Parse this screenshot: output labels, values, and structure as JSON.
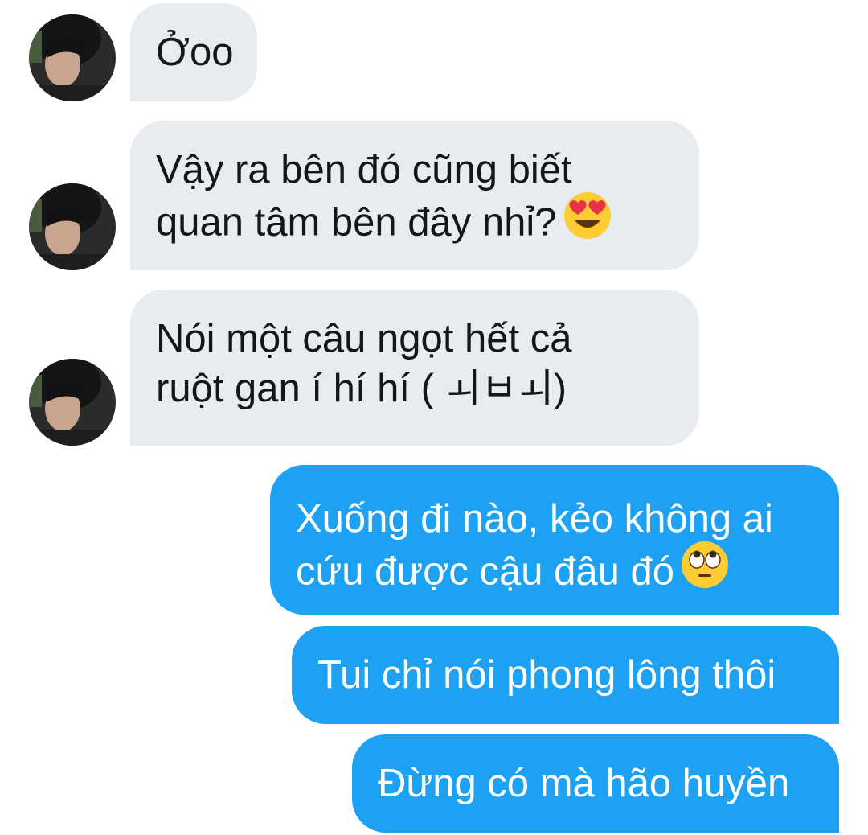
{
  "conversation": {
    "incoming": [
      {
        "text": "Ởoo"
      },
      {
        "line1": "Vậy ra bên đó cũng biết",
        "line2": "quan tâm bên đây nhỉ?",
        "emoji": "heart-eyes-emoji"
      },
      {
        "line1": "Nói một câu ngọt hết cả",
        "line2": "ruột gan í hí hí ( ㅚㅂㅚ)"
      }
    ],
    "outgoing": [
      {
        "line1": "Xuống đi nào, kẻo không ai",
        "line2": "cứu được cậu đâu đó",
        "emoji": "eye-roll-emoji"
      },
      {
        "text": "Tui chỉ nói phong lông thôi"
      },
      {
        "text": "Đừng có mà hão huyền"
      }
    ]
  },
  "colors": {
    "incoming_bubble": "#e6ecf0",
    "outgoing_bubble": "#1da1f2",
    "incoming_text": "#14171a",
    "outgoing_text": "#ffffff"
  }
}
